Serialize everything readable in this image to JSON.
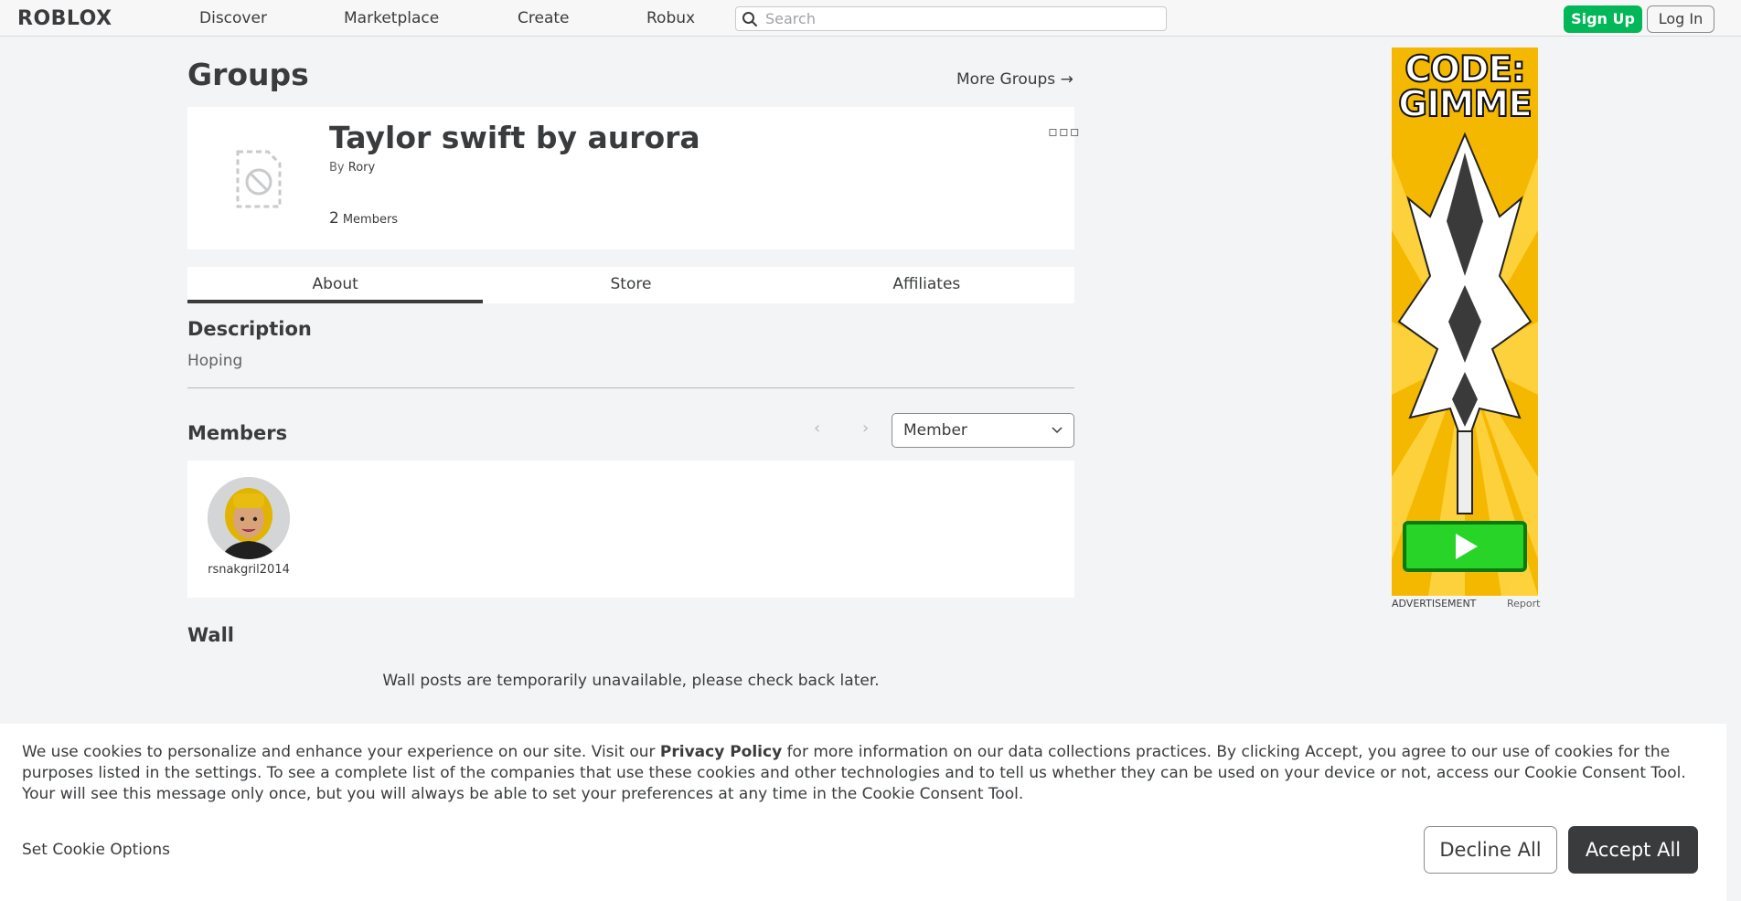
{
  "nav": {
    "logo": "ROBLOX",
    "links": [
      "Discover",
      "Marketplace",
      "Create",
      "Robux"
    ],
    "search_placeholder": "Search",
    "signup": "Sign Up",
    "login": "Log In"
  },
  "page": {
    "title": "Groups",
    "more_groups": "More Groups →"
  },
  "group": {
    "name": "Taylor swift by aurora",
    "by_label": "By",
    "owner": "Rory",
    "member_count": "2",
    "members_label": "Members"
  },
  "tabs": [
    {
      "label": "About",
      "active": true
    },
    {
      "label": "Store",
      "active": false
    },
    {
      "label": "Affiliates",
      "active": false
    }
  ],
  "description": {
    "heading": "Description",
    "text": "Hoping"
  },
  "members": {
    "heading": "Members",
    "role_selected": "Member",
    "list": [
      {
        "username": "rsnakgril2014"
      }
    ]
  },
  "wall": {
    "heading": "Wall",
    "message": "Wall posts are temporarily unavailable, please check back later."
  },
  "ad": {
    "headline": "CODE: GIMME",
    "label": "ADVERTISEMENT",
    "report": "Report"
  },
  "cookie": {
    "text_before": "We use cookies to personalize and enhance your experience on our site. Visit our ",
    "privacy_link": "Privacy Policy",
    "text_after": " for more information on our data collections practices. By clicking Accept, you agree to our use of cookies for the purposes listed in the settings. To see a complete list of the companies that use these cookies and other technologies and to tell us whether they can be used on your device or not, access our Cookie Consent Tool. Your will see this message only once, but you will always be able to set your preferences at any time in the Cookie Consent Tool.",
    "set_options": "Set Cookie Options",
    "decline": "Decline All",
    "accept": "Accept All"
  }
}
